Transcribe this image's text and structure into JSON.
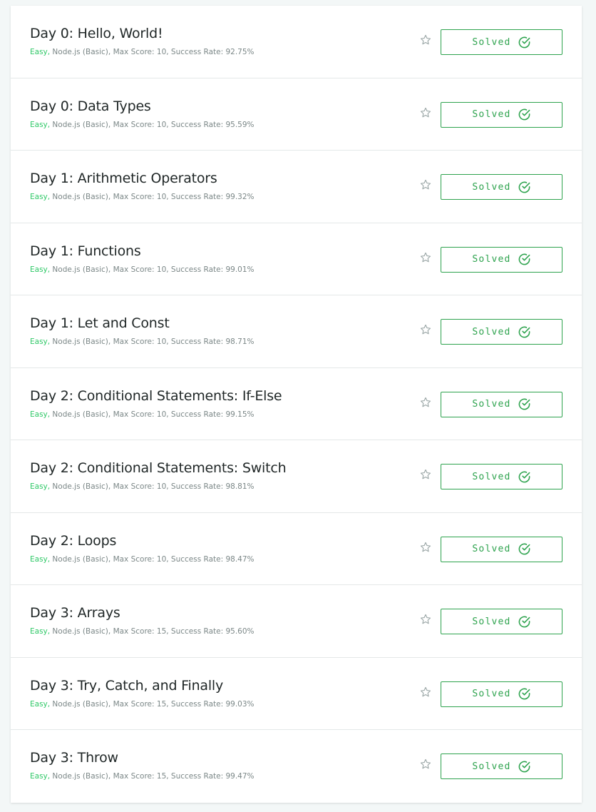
{
  "colors": {
    "accent_green": "#2ec866",
    "solved_green": "#2ea34e",
    "title_text": "#1f2626",
    "meta_text": "#7b8787"
  },
  "challenges": [
    {
      "title": "Day 0: Hello, World!",
      "difficulty": "Easy,",
      "details": " Node.js (Basic), Max Score: 10, Success Rate: 92.75%",
      "status": "Solved",
      "star_icon": "star-outline-icon",
      "status_icon": "check-circle-icon"
    },
    {
      "title": "Day 0: Data Types",
      "difficulty": "Easy,",
      "details": " Node.js (Basic), Max Score: 10, Success Rate: 95.59%",
      "status": "Solved",
      "star_icon": "star-outline-icon",
      "status_icon": "check-circle-icon"
    },
    {
      "title": "Day 1: Arithmetic Operators",
      "difficulty": "Easy,",
      "details": " Node.js (Basic), Max Score: 10, Success Rate: 99.32%",
      "status": "Solved",
      "star_icon": "star-outline-icon",
      "status_icon": "check-circle-icon"
    },
    {
      "title": "Day 1: Functions",
      "difficulty": "Easy,",
      "details": " Node.js (Basic), Max Score: 10, Success Rate: 99.01%",
      "status": "Solved",
      "star_icon": "star-outline-icon",
      "status_icon": "check-circle-icon"
    },
    {
      "title": "Day 1: Let and Const",
      "difficulty": "Easy,",
      "details": " Node.js (Basic), Max Score: 10, Success Rate: 98.71%",
      "status": "Solved",
      "star_icon": "star-outline-icon",
      "status_icon": "check-circle-icon"
    },
    {
      "title": "Day 2: Conditional Statements: If-Else",
      "difficulty": "Easy,",
      "details": " Node.js (Basic), Max Score: 10, Success Rate: 99.15%",
      "status": "Solved",
      "star_icon": "star-outline-icon",
      "status_icon": "check-circle-icon"
    },
    {
      "title": "Day 2: Conditional Statements: Switch",
      "difficulty": "Easy,",
      "details": " Node.js (Basic), Max Score: 10, Success Rate: 98.81%",
      "status": "Solved",
      "star_icon": "star-outline-icon",
      "status_icon": "check-circle-icon"
    },
    {
      "title": "Day 2: Loops",
      "difficulty": "Easy,",
      "details": " Node.js (Basic), Max Score: 10, Success Rate: 98.47%",
      "status": "Solved",
      "star_icon": "star-outline-icon",
      "status_icon": "check-circle-icon"
    },
    {
      "title": "Day 3: Arrays",
      "difficulty": "Easy,",
      "details": " Node.js (Basic), Max Score: 15, Success Rate: 95.60%",
      "status": "Solved",
      "star_icon": "star-outline-icon",
      "status_icon": "check-circle-icon"
    },
    {
      "title": "Day 3: Try, Catch, and Finally",
      "difficulty": "Easy,",
      "details": " Node.js (Basic), Max Score: 15, Success Rate: 99.03%",
      "status": "Solved",
      "star_icon": "star-outline-icon",
      "status_icon": "check-circle-icon"
    },
    {
      "title": "Day 3: Throw",
      "difficulty": "Easy,",
      "details": " Node.js (Basic), Max Score: 15, Success Rate: 99.47%",
      "status": "Solved",
      "star_icon": "star-outline-icon",
      "status_icon": "check-circle-icon"
    }
  ]
}
